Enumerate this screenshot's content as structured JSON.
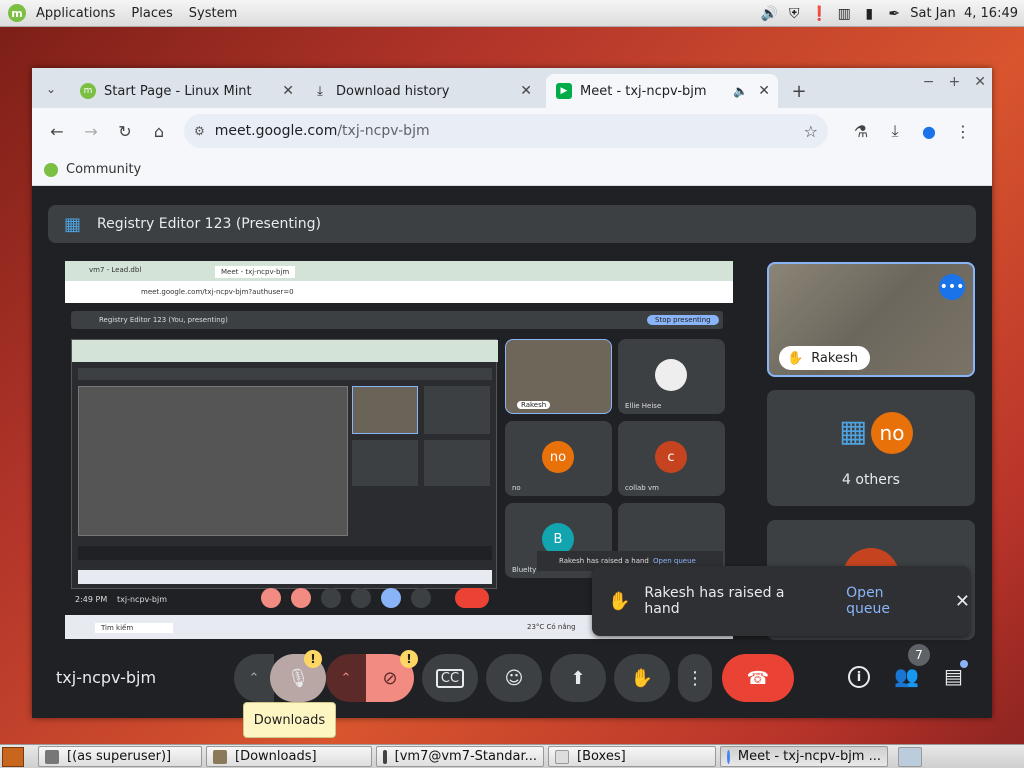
{
  "topbar": {
    "menus": [
      "Applications",
      "Places",
      "System"
    ],
    "clock": "Sat Jan  4, 16:49"
  },
  "browser": {
    "tabs": [
      {
        "title": "Start Page - Linux Mint"
      },
      {
        "title": "Download history"
      },
      {
        "title": "Meet - txj-ncpv-bjm"
      }
    ],
    "url_host": "meet.google.com",
    "url_path": "/txj-ncpv-bjm",
    "bookmark": "Community"
  },
  "meet": {
    "presenting_title": "Registry Editor 123 (Presenting)",
    "meeting_code": "txj-ncpv-bjm",
    "self_tile_name": "Rakesh",
    "others_label": "4 others",
    "others_avatar": "no",
    "toast": {
      "message": "Rakesh has raised a hand",
      "action": "Open queue"
    },
    "people_count": "7",
    "shared_screen": {
      "tabs": [
        "vm7 - Lead.dbl",
        "Meet - txj-ncpv-bjm"
      ],
      "url": "meet.google.com/txj-ncpv-bjm?authuser=0",
      "presenting": "Registry Editor 123 (You, presenting)",
      "stop": "Stop presenting",
      "tiles": [
        "Rakesh",
        "Ellie Heise",
        "no",
        "collab vm",
        "Bluelty"
      ],
      "avatars": [
        "no",
        "c",
        "B"
      ],
      "toast_text": "Rakesh has raised a hand",
      "toast_action": "Open queue",
      "time": "2:49 PM",
      "code": "txj-ncpv-bjm",
      "search": "Tim kiếm",
      "weather": "23°C  Có nắng"
    }
  },
  "tooltip": "Downloads",
  "taskbar": [
    {
      "label": "[(as superuser)]"
    },
    {
      "label": "[Downloads]"
    },
    {
      "label": "[vm7@vm7-Standar..."
    },
    {
      "label": "[Boxes]"
    },
    {
      "label": "Meet - txj-ncpv-bjm ..."
    }
  ],
  "colors": {
    "meet_bg": "#202124",
    "tile_bg": "#3c4043",
    "end_call": "#ea4335",
    "camera_off": "#f28b82",
    "link": "#8ab4f8",
    "avatar_orange": "#e8710a"
  }
}
